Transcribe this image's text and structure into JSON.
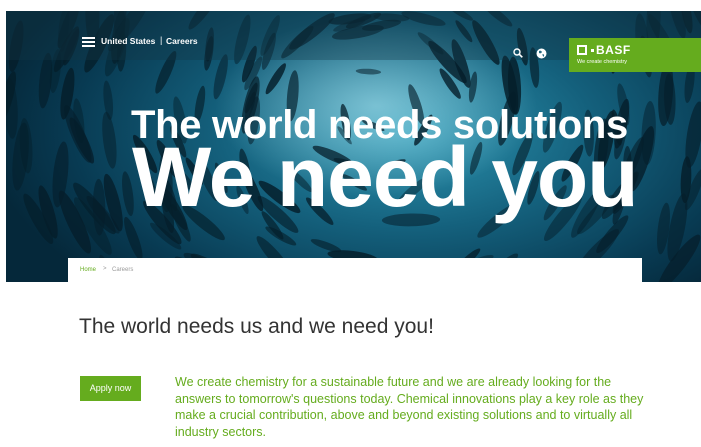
{
  "header": {
    "country": "United States",
    "separator": "|",
    "section": "Careers",
    "icons": [
      "menu-icon",
      "search-icon",
      "globe-icon"
    ]
  },
  "brand": {
    "name": "BASF",
    "tagline": "We create chemistry",
    "color": "#65ac1e"
  },
  "hero": {
    "line1": "The world needs solutions",
    "line2": "We need you"
  },
  "breadcrumb": {
    "home": "Home",
    "separator": ">",
    "current": "Careers"
  },
  "main": {
    "title": "The world needs us and we need you!",
    "apply_label": "Apply now",
    "intro": "We create chemistry for a sustainable future and we are already looking for the answers to tomorrow's questions today. Chemical innovations play a key role as they make a crucial contribution, above and beyond existing solutions and to virtually all industry sectors."
  },
  "colors": {
    "accent": "#65ac1e",
    "hero_dark": "#083a52",
    "text": "#333333"
  }
}
